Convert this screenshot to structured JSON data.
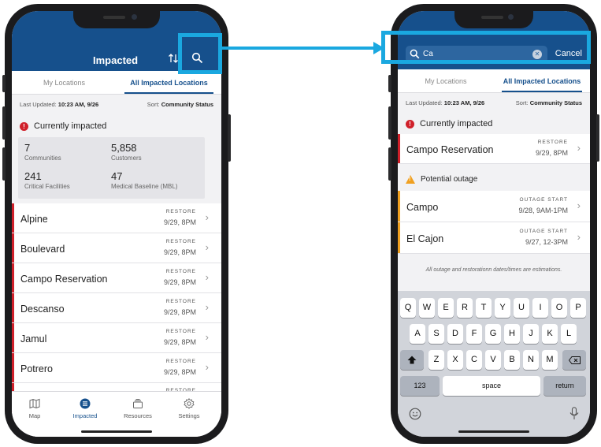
{
  "left_phone": {
    "header_title": "Impacted",
    "tabs": [
      "My Locations",
      "All Impacted Locations"
    ],
    "last_updated_label": "Last Updated:",
    "last_updated_value": "10:23 AM, 9/26",
    "sort_label": "Sort:",
    "sort_value": "Community Status",
    "section_title": "Currently impacted",
    "alert_glyph": "!",
    "stats": [
      {
        "value": "7",
        "label": "Communities"
      },
      {
        "value": "5,858",
        "label": "Customers"
      },
      {
        "value": "241",
        "label": "Critical Facilities"
      },
      {
        "value": "47",
        "label": "Medical Baseline (MBL)"
      }
    ],
    "locations": [
      {
        "name": "Alpine",
        "status": "RESTORE",
        "time": "9/29, 8PM"
      },
      {
        "name": "Boulevard",
        "status": "RESTORE",
        "time": "9/29, 8PM"
      },
      {
        "name": "Campo Reservation",
        "status": "RESTORE",
        "time": "9/29, 8PM"
      },
      {
        "name": "Descanso",
        "status": "RESTORE",
        "time": "9/29, 8PM"
      },
      {
        "name": "Jamul",
        "status": "RESTORE",
        "time": "9/29, 8PM"
      },
      {
        "name": "Potrero",
        "status": "RESTORE",
        "time": "9/29, 8PM"
      },
      {
        "name": "",
        "status": "RESTORE",
        "time": ""
      }
    ],
    "tabbar": [
      {
        "label": "Map",
        "icon": "map-icon"
      },
      {
        "label": "Impacted",
        "icon": "list-icon"
      },
      {
        "label": "Resources",
        "icon": "resources-icon"
      },
      {
        "label": "Settings",
        "icon": "gear-icon"
      }
    ]
  },
  "right_phone": {
    "search_value": "Ca",
    "clear_glyph": "✕",
    "cancel_label": "Cancel",
    "tabs": [
      "My Locations",
      "All Impacted Locations"
    ],
    "last_updated_label": "Last Updated:",
    "last_updated_value": "10:23 AM, 9/26",
    "sort_label": "Sort:",
    "sort_value": "Community Status",
    "impacted_title": "Currently impacted",
    "alert_glyph": "!",
    "impacted": [
      {
        "name": "Campo Reservation",
        "status": "RESTORE",
        "time": "9/29, 8PM"
      }
    ],
    "potential_title": "Potential outage",
    "warn_glyph": "!",
    "potential": [
      {
        "name": "Campo",
        "status": "OUTAGE START",
        "time": "9/28, 9AM-1PM"
      },
      {
        "name": "El Cajon",
        "status": "OUTAGE START",
        "time": "9/27, 12-3PM"
      }
    ],
    "disclaimer": "All outage and restorationn dates/times are estimations.",
    "keyboard": {
      "row1": [
        "Q",
        "W",
        "E",
        "R",
        "T",
        "Y",
        "U",
        "I",
        "O",
        "P"
      ],
      "row2": [
        "A",
        "S",
        "D",
        "F",
        "G",
        "H",
        "J",
        "K",
        "L"
      ],
      "row3": [
        "Z",
        "X",
        "C",
        "V",
        "B",
        "N",
        "M"
      ],
      "num_key": "123",
      "space_key": "space",
      "return_key": "return"
    }
  },
  "colors": {
    "header_blue": "#16508c",
    "highlight": "#1aa8e0",
    "impacted_red": "#d0202a",
    "potential_orange": "#f0a020"
  }
}
